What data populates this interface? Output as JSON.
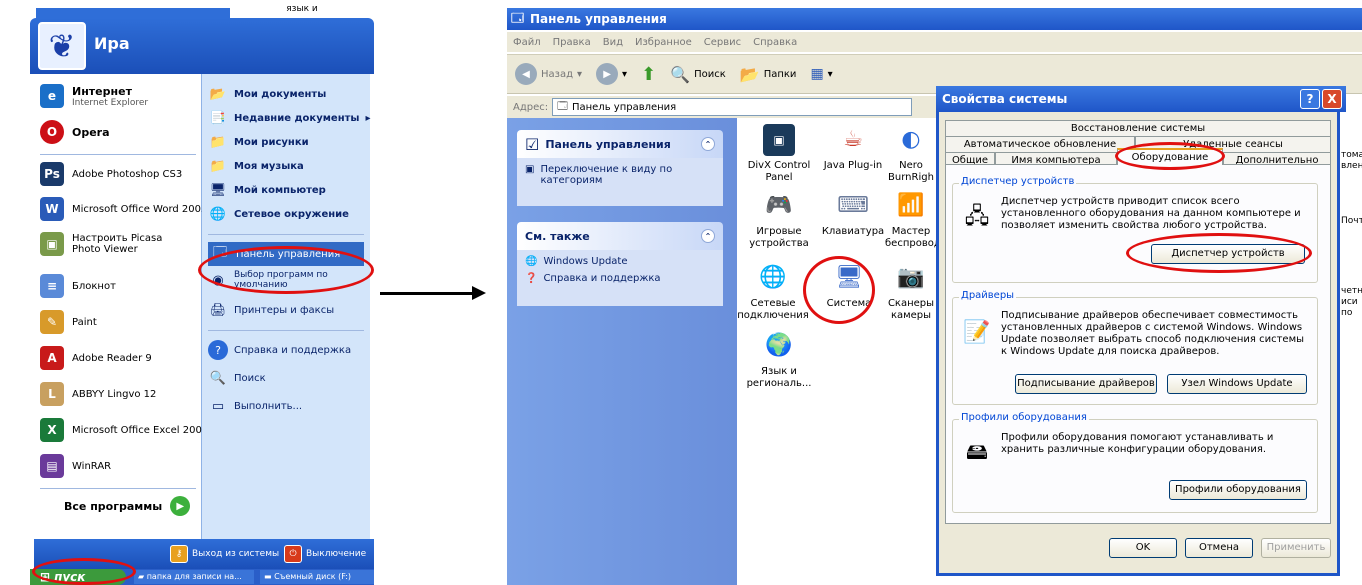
{
  "start_menu": {
    "top_fragment": "язык и",
    "user_name": "Ира",
    "pinned": [
      {
        "title": "Интернет",
        "subtitle": "Internet Explorer",
        "icon": "internet-explorer-icon",
        "color": "#1a6fc8"
      },
      {
        "title": "Opera",
        "subtitle": "",
        "icon": "opera-icon",
        "color": "#cc0f16"
      }
    ],
    "recent": [
      {
        "label": "Adobe Photoshop CS3",
        "icon": "photoshop-icon",
        "color": "#1a3a6a"
      },
      {
        "label": "Microsoft Office Word 2003",
        "icon": "word-icon",
        "color": "#2a5bb8"
      },
      {
        "label": "Настроить Picasa Photo Viewer",
        "icon": "picasa-icon",
        "color": "#7a9a4a"
      },
      {
        "label": "Блокнот",
        "icon": "notepad-icon",
        "color": "#5a8ad8"
      },
      {
        "label": "Paint",
        "icon": "paint-icon",
        "color": "#d89a2a"
      },
      {
        "label": "Adobe Reader 9",
        "icon": "adobe-reader-icon",
        "color": "#c81a1a"
      },
      {
        "label": "ABBYY Lingvo 12",
        "icon": "lingvo-icon",
        "color": "#c8a060"
      },
      {
        "label": "Microsoft Office Excel 2003",
        "icon": "excel-icon",
        "color": "#1a7a3a"
      },
      {
        "label": "WinRAR",
        "icon": "winrar-icon",
        "color": "#6a3a9a"
      }
    ],
    "all_programs": "Все программы",
    "right_items": [
      {
        "label": "Мои документы",
        "bold": true,
        "icon": "folder-icon"
      },
      {
        "label": "Недавние документы",
        "bold": true,
        "icon": "recent-docs-icon"
      },
      {
        "label": "Мои рисунки",
        "bold": true,
        "icon": "pictures-icon"
      },
      {
        "label": "Моя музыка",
        "bold": true,
        "icon": "music-icon"
      },
      {
        "label": "Мой компьютер",
        "bold": true,
        "icon": "computer-icon"
      },
      {
        "label": "Сетевое окружение",
        "bold": true,
        "icon": "network-icon"
      },
      {
        "label": "Панель управления",
        "bold": false,
        "icon": "control-panel-icon"
      },
      {
        "label": "Выбор программ по умолчанию",
        "bold": false,
        "icon": "default-programs-icon"
      },
      {
        "label": "Принтеры и факсы",
        "bold": false,
        "icon": "printer-icon"
      },
      {
        "label": "Справка и поддержка",
        "bold": false,
        "icon": "help-icon"
      },
      {
        "label": "Поиск",
        "bold": false,
        "icon": "search-icon"
      },
      {
        "label": "Выполнить...",
        "bold": false,
        "icon": "run-icon"
      }
    ],
    "logoff": "Выход из системы",
    "shutdown": "Выключение"
  },
  "taskbar": {
    "start": "пуск",
    "tasks": [
      "папка для записи на...",
      "Съемный диск (F:)"
    ]
  },
  "control_panel": {
    "title": "Панель управления",
    "menu": [
      "Файл",
      "Правка",
      "Вид",
      "Избранное",
      "Сервис",
      "Справка"
    ],
    "toolbar": {
      "back": "Назад",
      "search": "Поиск",
      "folders": "Папки"
    },
    "address_label": "Адрес:",
    "address_value": "Панель управления",
    "side_panel_title": "Панель управления",
    "switch_view": "Переключение к виду по категориям",
    "see_also_title": "См. также",
    "see_also": [
      "Windows Update",
      "Справка и поддержка"
    ],
    "icons": [
      {
        "label": "DivX Control Panel",
        "icon": "divx-icon"
      },
      {
        "label": "Java Plug-in",
        "icon": "java-icon"
      },
      {
        "label": "Nero BurnRigh",
        "icon": "nero-icon"
      },
      {
        "label": "Игровые устройства",
        "icon": "gamepad-icon"
      },
      {
        "label": "Клавиатура",
        "icon": "keyboard-icon"
      },
      {
        "label": "Мастер беспровод",
        "icon": "wireless-icon"
      },
      {
        "label": "Сетевые подключения",
        "icon": "network-connections-icon"
      },
      {
        "label": "Система",
        "icon": "system-icon"
      },
      {
        "label": "Сканеры камеры",
        "icon": "scanner-icon"
      },
      {
        "label": "Язык и региональ...",
        "icon": "globe-icon"
      }
    ],
    "right_fragments": [
      "томати вление",
      "Почта",
      "четны иси по"
    ]
  },
  "dialog": {
    "title": "Свойства системы",
    "tabs_row1": [
      "Восстановление системы"
    ],
    "tabs_row2": [
      "Автоматическое обновление",
      "Удаленные сеансы"
    ],
    "tabs_row3": [
      "Общие",
      "Имя компьютера",
      "Оборудование",
      "Дополнительно"
    ],
    "groups": [
      {
        "label": "Диспетчер устройств",
        "text": "Диспетчер устройств приводит список всего установленного оборудования на данном компьютере и позволяет изменить свойства любого устройства.",
        "icon": "device-manager-icon",
        "buttons": [
          "Диспетчер устройств"
        ]
      },
      {
        "label": "Драйверы",
        "text": "Подписывание драйверов обеспечивает совместимость установленных драйверов с системой Windows. Windows Update позволяет выбрать способ подключения системы к Windows Update для поиска драйверов.",
        "icon": "drivers-icon",
        "buttons": [
          "Подписывание драйверов",
          "Узел Windows Update"
        ]
      },
      {
        "label": "Профили оборудования",
        "text": "Профили оборудования помогают устанавливать и хранить различные конфигурации оборудования.",
        "icon": "hardware-profiles-icon",
        "buttons": [
          "Профили оборудования"
        ]
      }
    ],
    "ok": "OK",
    "cancel": "Отмена",
    "apply": "Применить",
    "help_btn": "?",
    "close_btn": "X"
  },
  "colors": {
    "xp_blue": "#1f56c8",
    "highlight_red": "#e01010",
    "panel_blue": "#d3e5fa"
  }
}
